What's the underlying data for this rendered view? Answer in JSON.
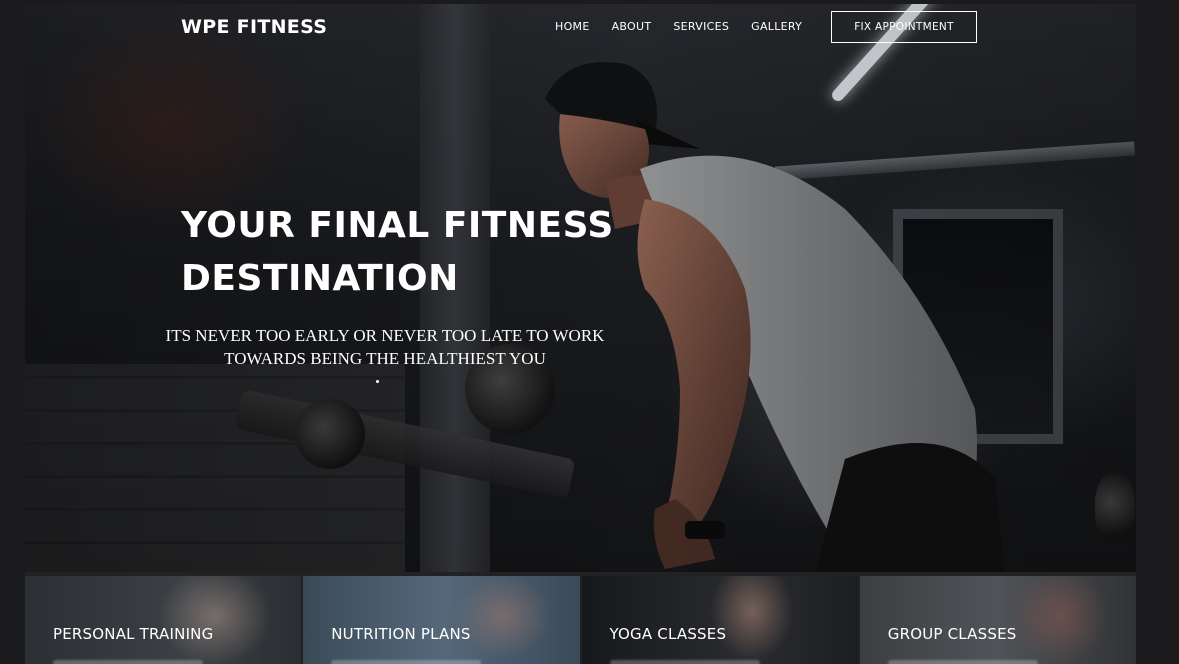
{
  "brand": {
    "name": "WPE FITNESS"
  },
  "nav": {
    "items": [
      {
        "label": "HOME"
      },
      {
        "label": "ABOUT"
      },
      {
        "label": "SERVICES"
      },
      {
        "label": "GALLERY"
      }
    ],
    "cta_label": "FIX APPOINTMENT"
  },
  "hero": {
    "headline_line1": "YOUR FINAL FITNESS",
    "headline_line2": "DESTINATION",
    "subline_line1": "ITS NEVER TOO EARLY OR NEVER TOO LATE TO WORK",
    "subline_line2": "TOWARDS BEING THE HEALTHIEST YOU"
  },
  "services": [
    {
      "title": "PERSONAL TRAINING"
    },
    {
      "title": "NUTRITION PLANS"
    },
    {
      "title": "YOGA CLASSES"
    },
    {
      "title": "GROUP CLASSES"
    }
  ],
  "colors": {
    "text": "#ffffff",
    "page_bg": "#1b1b1d",
    "card_overlay": "#1f2a33"
  }
}
